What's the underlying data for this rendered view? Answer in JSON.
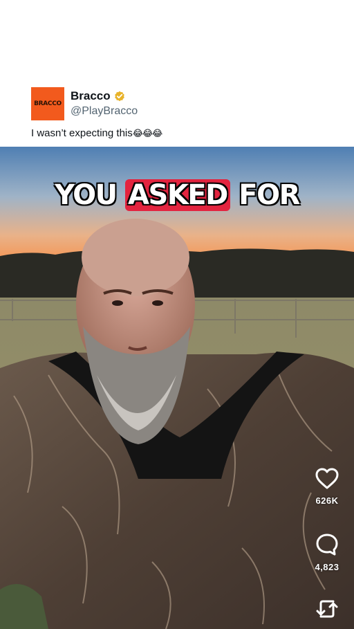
{
  "post": {
    "avatar_text": "BRACCO",
    "display_name": "Bracco",
    "handle": "@PlayBracco",
    "text": "I wasn’t expecting this",
    "emojis": "😂😂😂",
    "brand_color": "#f25a1d",
    "verified_color": "#e8b32a"
  },
  "video": {
    "caption_before": "YOU ",
    "caption_highlight": "ASKED",
    "caption_after": " FOR",
    "highlight_color": "#e3243f"
  },
  "actions": {
    "like_count": "626K",
    "comment_count": "4,823",
    "like_icon": "heart-icon",
    "comment_icon": "comment-bubble-icon",
    "share_icon": "repost-icon"
  }
}
